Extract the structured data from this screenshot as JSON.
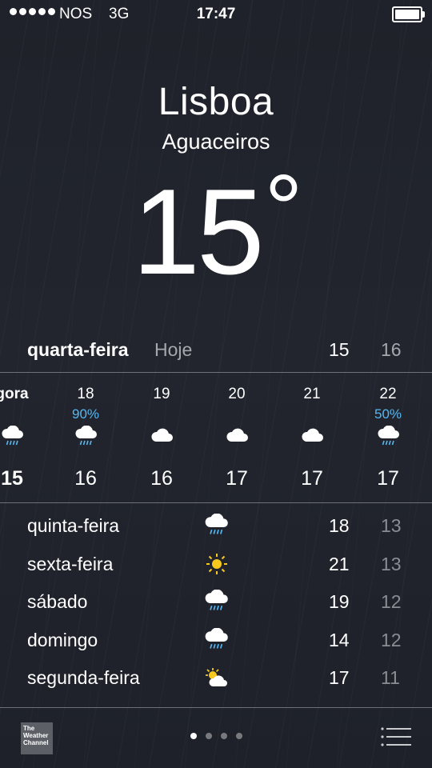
{
  "status_bar": {
    "carrier": "NOS",
    "network": "3G",
    "time": "17:47",
    "signal_bars": 5,
    "battery_level": 1.0
  },
  "location": {
    "city": "Lisboa",
    "condition": "Aguaceiros",
    "temperature": "15",
    "degree_symbol": "°"
  },
  "today": {
    "day": "quarta-feira",
    "label": "Hoje",
    "high": "15",
    "low": "16"
  },
  "hourly": [
    {
      "time": "gora",
      "precip": "",
      "icon": "cloud-rain-icon",
      "temp": "15"
    },
    {
      "time": "18",
      "precip": "90%",
      "icon": "cloud-rain-icon",
      "temp": "16"
    },
    {
      "time": "19",
      "precip": "",
      "icon": "cloud-icon",
      "temp": "16"
    },
    {
      "time": "20",
      "precip": "",
      "icon": "cloud-icon",
      "temp": "17"
    },
    {
      "time": "21",
      "precip": "",
      "icon": "cloud-icon",
      "temp": "17"
    },
    {
      "time": "22",
      "precip": "50%",
      "icon": "cloud-rain-icon",
      "temp": "17"
    }
  ],
  "daily": [
    {
      "day": "quinta-feira",
      "icon": "cloud-rain-icon",
      "high": "18",
      "low": "13"
    },
    {
      "day": "sexta-feira",
      "icon": "sun-icon",
      "high": "21",
      "low": "13"
    },
    {
      "day": "sábado",
      "icon": "cloud-rain-icon",
      "high": "19",
      "low": "12"
    },
    {
      "day": "domingo",
      "icon": "cloud-rain-icon",
      "high": "14",
      "low": "12"
    },
    {
      "day": "segunda-feira",
      "icon": "partly-cloudy-icon",
      "high": "17",
      "low": "11"
    }
  ],
  "footer": {
    "logo_text": "The Weather Channel",
    "pages": 4,
    "active_page": 0
  },
  "colors": {
    "background": "#20232b",
    "precip_blue": "#55b7f2",
    "sun_yellow": "#f7c91d",
    "muted_text": "#8a8d93"
  }
}
